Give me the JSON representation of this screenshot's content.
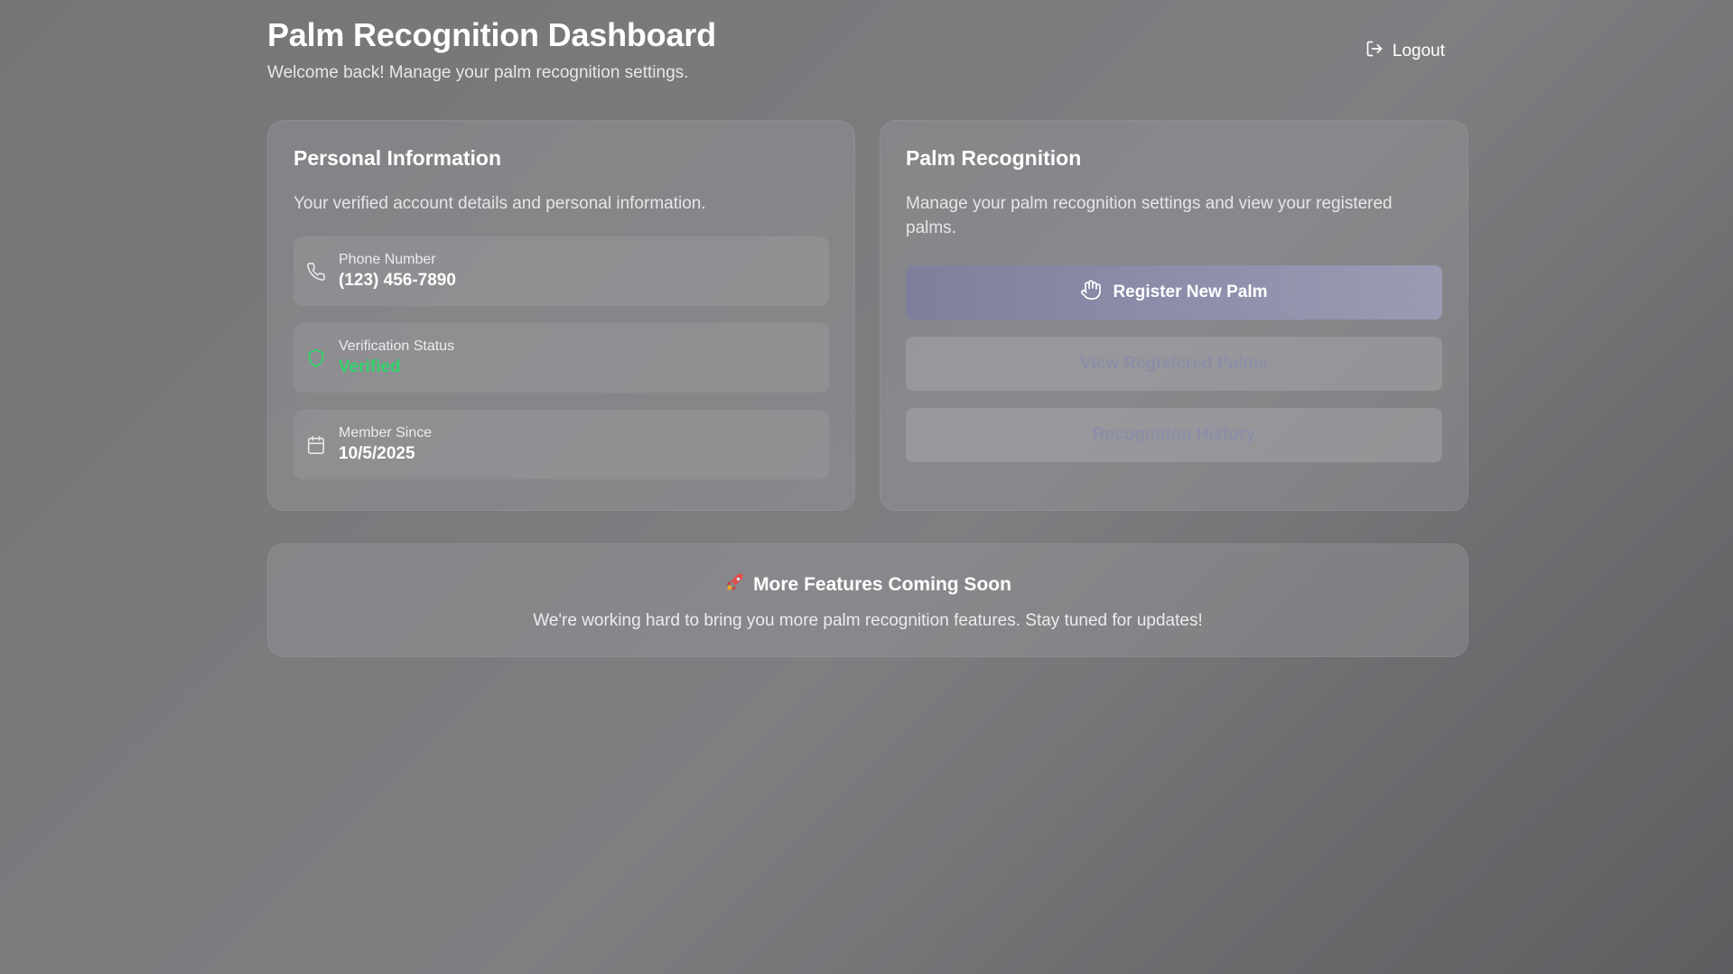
{
  "header": {
    "title": "Palm Recognition Dashboard",
    "subtitle": "Welcome back! Manage your palm recognition settings.",
    "logout_label": "Logout"
  },
  "personal_info": {
    "title": "Personal Information",
    "description": "Your verified account details and personal information.",
    "items": [
      {
        "icon": "phone-icon",
        "label": "Phone Number",
        "value": "(123) 456-7890"
      },
      {
        "icon": "shield-icon",
        "label": "Verification Status",
        "value": "Verified"
      },
      {
        "icon": "calendar-icon",
        "label": "Member Since",
        "value": "10/5/2025"
      }
    ]
  },
  "palm_recognition": {
    "title": "Palm Recognition",
    "description": "Manage your palm recognition settings and view your registered palms.",
    "register_label": "Register New Palm",
    "view_label": "View Registered Palms",
    "history_label": "Recognition History"
  },
  "features": {
    "title": "More Features Coming Soon",
    "text": "We're working hard to bring you more palm recognition features. Stay tuned for updates!"
  },
  "colors": {
    "verified": "#2fd46b",
    "primary_button": "#8d8fab",
    "secondary_button_text": "#8c8ea6"
  }
}
